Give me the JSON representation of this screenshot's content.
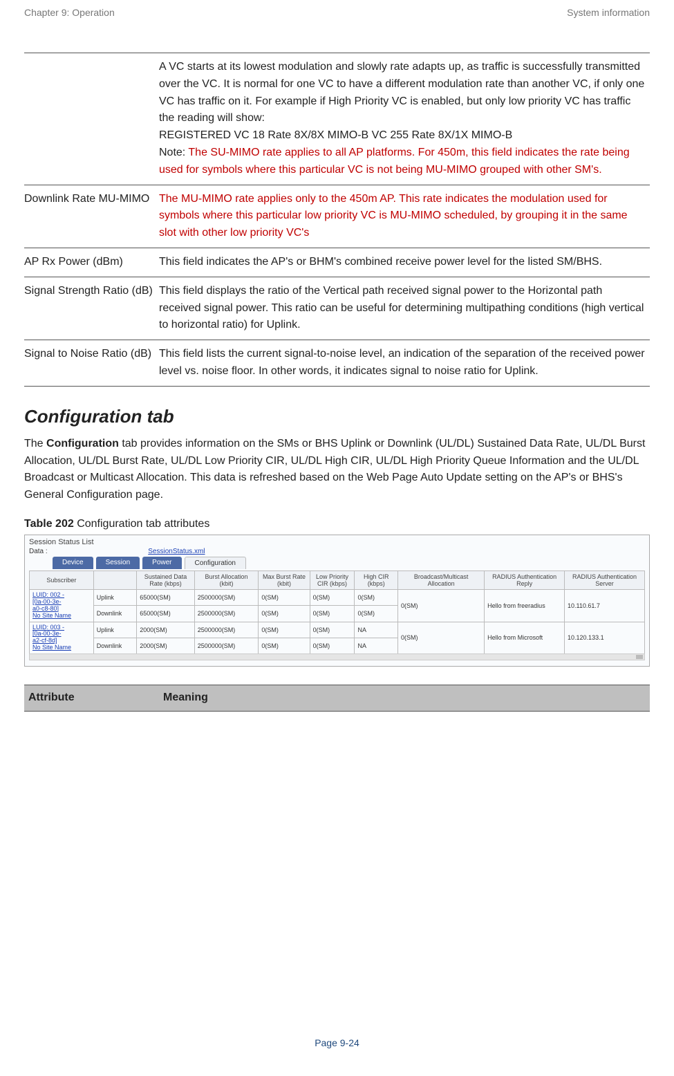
{
  "header": {
    "left": "Chapter 9:  Operation",
    "right": "System information"
  },
  "table1": {
    "rows": [
      {
        "name": "",
        "body_plain": "A VC starts at its lowest modulation and slowly rate adapts up, as traffic is successfully transmitted over the VC. It is normal for one VC to have a different modulation rate than another VC, if only one VC has traffic on it. For example if High Priority VC is enabled, but only low priority VC has traffic the reading will show:\nREGISTERED VC 18 Rate 8X/8X MIMO-B VC 255 Rate 8X/1X MIMO-B",
        "note_prefix": "Note: ",
        "note_red": "The SU-MIMO rate applies to all AP platforms. For 450m, this field indicates the rate being used for symbols where this particular VC is not being MU-MIMO grouped with other SM's."
      },
      {
        "name": "Downlink Rate  MU-MIMO",
        "body_red": "The MU-MIMO rate applies only to the 450m AP. This rate indicates the modulation used for symbols where this particular low priority VC is MU-MIMO scheduled, by grouping it in the same slot with other low priority VC's"
      },
      {
        "name": "AP Rx Power (dBm)",
        "body_plain": "This field indicates the AP's or BHM's combined receive power level for the listed SM/BHS."
      },
      {
        "name": "Signal Strength Ratio (dB)",
        "body_plain": "This field displays the ratio of the Vertical path received signal power to the Horizontal path received signal power. This ratio can be useful for determining multipathing conditions (high vertical to horizontal ratio) for Uplink."
      },
      {
        "name": "Signal to Noise Ratio (dB)",
        "body_plain": "This field lists the current signal-to-noise level, an indication of the separation of the received power level vs. noise floor. In other words, it indicates signal to noise ratio for Uplink."
      }
    ]
  },
  "section": {
    "heading": "Configuration tab",
    "para_prefix": "The ",
    "para_bold": "Configuration",
    "para_rest": " tab provides information on the SMs or BHS Uplink or Downlink (UL/DL) Sustained Data Rate, UL/DL Burst Allocation, UL/DL Burst Rate, UL/DL Low Priority CIR, UL/DL High CIR, UL/DL High Priority Queue Information and the UL/DL Broadcast or Multicast Allocation. This data is refreshed based on the Web Page Auto Update setting on the AP's or BHS's General Configuration page."
  },
  "caption": {
    "bold": "Table 202",
    "rest": " Configuration tab attributes"
  },
  "figure": {
    "panel_title": "Session Status List",
    "data_label": "Data :",
    "data_value": "SessionStatus.xml",
    "tabs": [
      "Device",
      "Session",
      "Power",
      "Configuration"
    ],
    "columns": [
      "Subscriber",
      "",
      "Sustained Data Rate (kbps)",
      "Burst Allocation (kbit)",
      "Max Burst Rate (kbit)",
      "Low Priority CIR (kbps)",
      "High CIR (kbps)",
      "Broadcast/Multicast Allocation",
      "RADIUS Authentication Reply",
      "RADIUS Authentication Server"
    ],
    "groups": [
      {
        "subscriber": [
          "LUID: 002 -",
          "[0a-00-3e-",
          "a0-c8-80]",
          "No Site Name"
        ],
        "rows": [
          {
            "dir": "Uplink",
            "sdr": "65000(SM)",
            "ba": "2500000(SM)",
            "mbr": "0(SM)",
            "lpc": "0(SM)",
            "hc": "0(SM)"
          },
          {
            "dir": "Downlink",
            "sdr": "65000(SM)",
            "ba": "2500000(SM)",
            "mbr": "0(SM)",
            "lpc": "0(SM)",
            "hc": "0(SM)"
          }
        ],
        "bma": "0(SM)",
        "rar": "Hello from freeradius",
        "ras": "10.110.61.7"
      },
      {
        "subscriber": [
          "LUID: 003 -",
          "[0a-00-3e-",
          "a2-cf-8d]",
          "No Site Name"
        ],
        "rows": [
          {
            "dir": "Uplink",
            "sdr": "2000(SM)",
            "ba": "2500000(SM)",
            "mbr": "0(SM)",
            "lpc": "0(SM)",
            "hc": "NA"
          },
          {
            "dir": "Downlink",
            "sdr": "2000(SM)",
            "ba": "2500000(SM)",
            "mbr": "0(SM)",
            "lpc": "0(SM)",
            "hc": "NA"
          }
        ],
        "bma": "0(SM)",
        "rar": "Hello from Microsoft",
        "ras": "10.120.133.1"
      }
    ]
  },
  "table2_header": {
    "c1": "Attribute",
    "c2": "Meaning"
  },
  "footer": {
    "text": "Page 9-24"
  }
}
